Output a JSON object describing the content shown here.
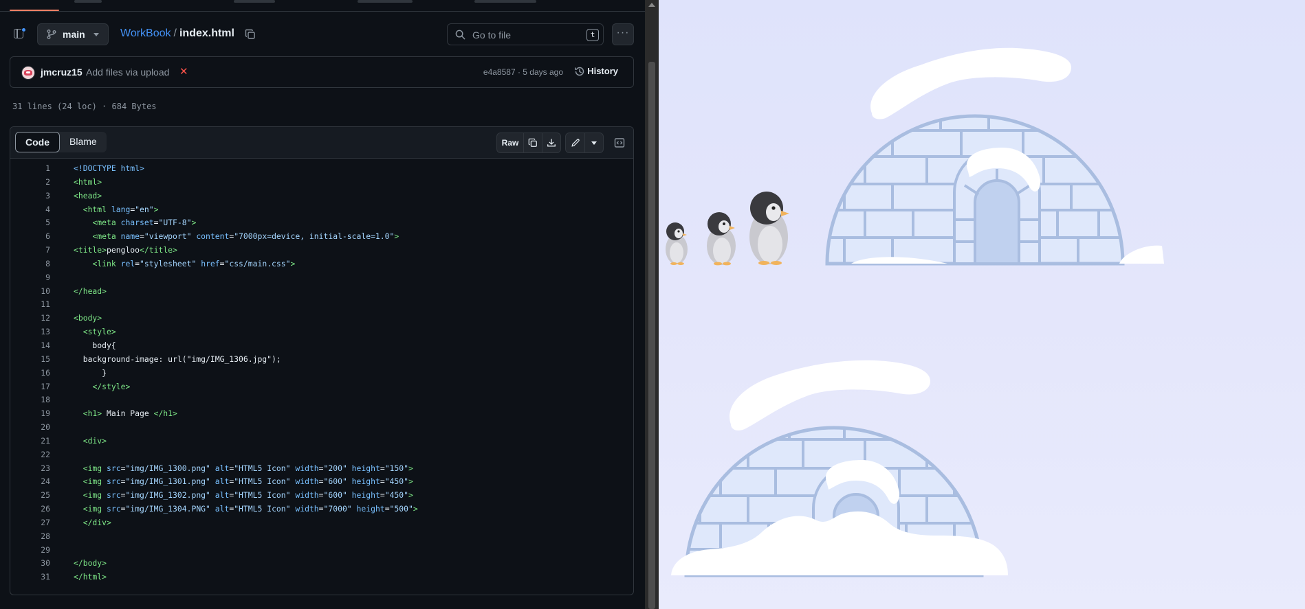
{
  "header": {
    "branch": "main",
    "repo": "WorkBook",
    "separator": "/",
    "file": "index.html",
    "search_placeholder": "Go to file",
    "search_shortcut": "t",
    "more_label": "···"
  },
  "commit": {
    "author": "jmcruz15",
    "message": "Add files via upload",
    "status": "✕",
    "sha_time": "e4a8587 · 5 days ago",
    "history_label": "History"
  },
  "file_info": "31 lines (24 loc) · 684 Bytes",
  "code_view": {
    "tabs": [
      "Code",
      "Blame"
    ],
    "raw_label": "Raw"
  },
  "code_lines": [
    {
      "n": "1",
      "parts": [
        [
          "dt",
          "<!DOCTYPE html>"
        ]
      ]
    },
    {
      "n": "2",
      "parts": [
        [
          "t",
          "<html>"
        ]
      ]
    },
    {
      "n": "3",
      "parts": [
        [
          "t",
          "<head>"
        ]
      ]
    },
    {
      "n": "4",
      "parts": [
        [
          "",
          "  "
        ],
        [
          "t",
          "<html"
        ],
        [
          "",
          " "
        ],
        [
          "a",
          "lang"
        ],
        [
          "",
          "="
        ],
        [
          "s",
          "\"en\""
        ],
        [
          "t",
          ">"
        ]
      ]
    },
    {
      "n": "5",
      "parts": [
        [
          "",
          "    "
        ],
        [
          "t",
          "<meta"
        ],
        [
          "",
          " "
        ],
        [
          "a",
          "charset"
        ],
        [
          "",
          "="
        ],
        [
          "s",
          "\"UTF-8\""
        ],
        [
          "t",
          ">"
        ]
      ]
    },
    {
      "n": "6",
      "parts": [
        [
          "",
          "    "
        ],
        [
          "t",
          "<meta"
        ],
        [
          "",
          " "
        ],
        [
          "a",
          "name"
        ],
        [
          "",
          "="
        ],
        [
          "s",
          "\"viewport\""
        ],
        [
          "",
          " "
        ],
        [
          "a",
          "content"
        ],
        [
          "",
          "="
        ],
        [
          "s",
          "\"7000px=device, initial-scale=1.0\""
        ],
        [
          "t",
          ">"
        ]
      ]
    },
    {
      "n": "7",
      "parts": [
        [
          "t",
          "<title>"
        ],
        [
          "",
          "pengloo"
        ],
        [
          "t",
          "</title>"
        ]
      ]
    },
    {
      "n": "8",
      "parts": [
        [
          "",
          "    "
        ],
        [
          "t",
          "<link"
        ],
        [
          "",
          " "
        ],
        [
          "a",
          "rel"
        ],
        [
          "",
          "="
        ],
        [
          "s",
          "\"stylesheet\""
        ],
        [
          "",
          " "
        ],
        [
          "a",
          "href"
        ],
        [
          "",
          "="
        ],
        [
          "s",
          "\"css/main.css\""
        ],
        [
          "t",
          ">"
        ]
      ]
    },
    {
      "n": "9",
      "parts": []
    },
    {
      "n": "10",
      "parts": [
        [
          "t",
          "</head>"
        ]
      ]
    },
    {
      "n": "11",
      "parts": []
    },
    {
      "n": "12",
      "parts": [
        [
          "t",
          "<body>"
        ]
      ]
    },
    {
      "n": "13",
      "parts": [
        [
          "",
          "  "
        ],
        [
          "t",
          "<style>"
        ]
      ]
    },
    {
      "n": "14",
      "parts": [
        [
          "",
          "    body{"
        ]
      ]
    },
    {
      "n": "15",
      "parts": [
        [
          "",
          "  background-image: url(\"img/IMG_1306.jpg\");"
        ]
      ]
    },
    {
      "n": "16",
      "parts": [
        [
          "",
          "      }"
        ]
      ]
    },
    {
      "n": "17",
      "parts": [
        [
          "",
          "    "
        ],
        [
          "t",
          "</style>"
        ]
      ]
    },
    {
      "n": "18",
      "parts": []
    },
    {
      "n": "19",
      "parts": [
        [
          "",
          "  "
        ],
        [
          "t",
          "<h1>"
        ],
        [
          "",
          " Main Page "
        ],
        [
          "t",
          "</h1>"
        ]
      ]
    },
    {
      "n": "20",
      "parts": []
    },
    {
      "n": "21",
      "parts": [
        [
          "",
          "  "
        ],
        [
          "t",
          "<div>"
        ]
      ]
    },
    {
      "n": "22",
      "parts": []
    },
    {
      "n": "23",
      "parts": [
        [
          "",
          "  "
        ],
        [
          "t",
          "<img"
        ],
        [
          "",
          " "
        ],
        [
          "a",
          "src"
        ],
        [
          "",
          "="
        ],
        [
          "s",
          "\"img/IMG_1300.png\""
        ],
        [
          "",
          " "
        ],
        [
          "a",
          "alt"
        ],
        [
          "",
          "="
        ],
        [
          "s",
          "\"HTML5 Icon\""
        ],
        [
          "",
          " "
        ],
        [
          "a",
          "width"
        ],
        [
          "",
          "="
        ],
        [
          "s",
          "\"200\""
        ],
        [
          "",
          " "
        ],
        [
          "a",
          "height"
        ],
        [
          "",
          "="
        ],
        [
          "s",
          "\"150\""
        ],
        [
          "t",
          ">"
        ]
      ]
    },
    {
      "n": "24",
      "parts": [
        [
          "",
          "  "
        ],
        [
          "t",
          "<img"
        ],
        [
          "",
          " "
        ],
        [
          "a",
          "src"
        ],
        [
          "",
          "="
        ],
        [
          "s",
          "\"img/IMG_1301.png\""
        ],
        [
          "",
          " "
        ],
        [
          "a",
          "alt"
        ],
        [
          "",
          "="
        ],
        [
          "s",
          "\"HTML5 Icon\""
        ],
        [
          "",
          " "
        ],
        [
          "a",
          "width"
        ],
        [
          "",
          "="
        ],
        [
          "s",
          "\"600\""
        ],
        [
          "",
          " "
        ],
        [
          "a",
          "height"
        ],
        [
          "",
          "="
        ],
        [
          "s",
          "\"450\""
        ],
        [
          "t",
          ">"
        ]
      ]
    },
    {
      "n": "25",
      "parts": [
        [
          "",
          "  "
        ],
        [
          "t",
          "<img"
        ],
        [
          "",
          " "
        ],
        [
          "a",
          "src"
        ],
        [
          "",
          "="
        ],
        [
          "s",
          "\"img/IMG_1302.png\""
        ],
        [
          "",
          " "
        ],
        [
          "a",
          "alt"
        ],
        [
          "",
          "="
        ],
        [
          "s",
          "\"HTML5 Icon\""
        ],
        [
          "",
          " "
        ],
        [
          "a",
          "width"
        ],
        [
          "",
          "="
        ],
        [
          "s",
          "\"600\""
        ],
        [
          "",
          " "
        ],
        [
          "a",
          "height"
        ],
        [
          "",
          "="
        ],
        [
          "s",
          "\"450\""
        ],
        [
          "t",
          ">"
        ]
      ]
    },
    {
      "n": "26",
      "parts": [
        [
          "",
          "  "
        ],
        [
          "t",
          "<img"
        ],
        [
          "",
          " "
        ],
        [
          "a",
          "src"
        ],
        [
          "",
          "="
        ],
        [
          "s",
          "\"img/IMG_1304.PNG\""
        ],
        [
          "",
          " "
        ],
        [
          "a",
          "alt"
        ],
        [
          "",
          "="
        ],
        [
          "s",
          "\"HTML5 Icon\""
        ],
        [
          "",
          " "
        ],
        [
          "a",
          "width"
        ],
        [
          "",
          "="
        ],
        [
          "s",
          "\"7000\""
        ],
        [
          "",
          " "
        ],
        [
          "a",
          "height"
        ],
        [
          "",
          "="
        ],
        [
          "s",
          "\"500\""
        ],
        [
          "t",
          ">"
        ]
      ]
    },
    {
      "n": "27",
      "parts": [
        [
          "",
          "  "
        ],
        [
          "t",
          "</div>"
        ]
      ]
    },
    {
      "n": "28",
      "parts": []
    },
    {
      "n": "29",
      "parts": []
    },
    {
      "n": "30",
      "parts": [
        [
          "t",
          "</body>"
        ]
      ]
    },
    {
      "n": "31",
      "parts": [
        [
          "t",
          "</html>"
        ]
      ]
    }
  ],
  "colors": {
    "accent_link": "#4493f8",
    "tag": "#7ee787",
    "attr": "#79c0ff",
    "string": "#a5d6ff",
    "preview_bg": "#e2e5fb",
    "igloo_brick": "#dfe8fb",
    "igloo_mortar": "#a9bde0",
    "snow": "#ffffff"
  },
  "preview": {
    "images": [
      "penguins-icon",
      "igloo-icon",
      "igloo-snowdrift-icon"
    ]
  }
}
